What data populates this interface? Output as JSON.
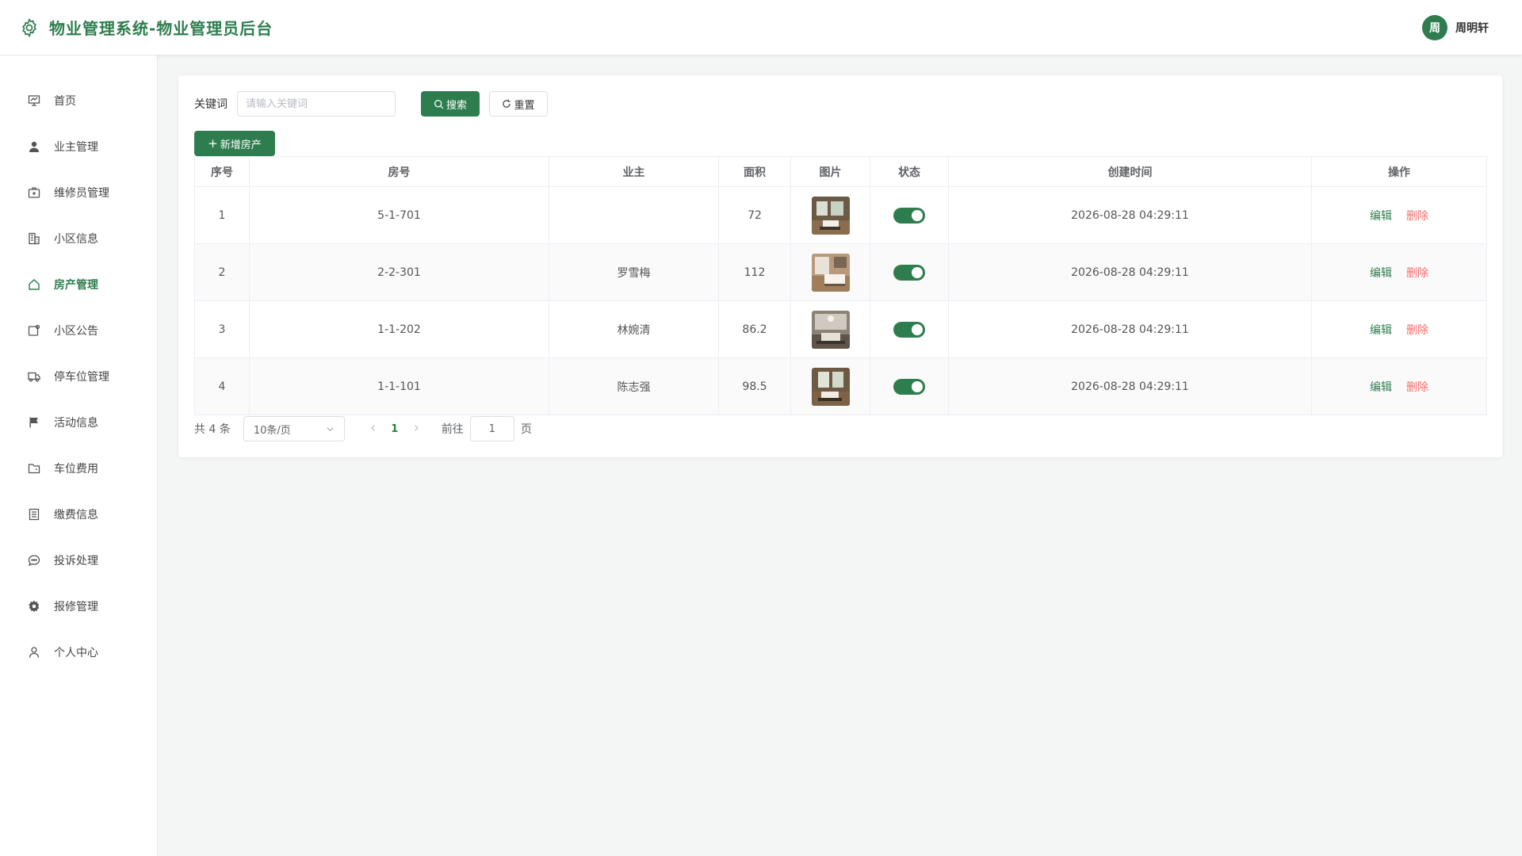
{
  "app": {
    "title": "物业管理系统-物业管理员后台",
    "accent": "#2e7d4f",
    "user": {
      "avatar_text": "周",
      "name": "周明轩"
    }
  },
  "sidebar": {
    "items": [
      {
        "label": "首页",
        "icon": "dashboard-icon",
        "active": false
      },
      {
        "label": "业主管理",
        "icon": "user-icon",
        "active": false
      },
      {
        "label": "维修员管理",
        "icon": "medkit-icon",
        "active": false
      },
      {
        "label": "小区信息",
        "icon": "building-icon",
        "active": false
      },
      {
        "label": "房产管理",
        "icon": "house-icon",
        "active": true
      },
      {
        "label": "小区公告",
        "icon": "notice-icon",
        "active": false
      },
      {
        "label": "停车位管理",
        "icon": "truck-icon",
        "active": false
      },
      {
        "label": "活动信息",
        "icon": "flag-icon",
        "active": false
      },
      {
        "label": "车位费用",
        "icon": "folder-icon",
        "active": false
      },
      {
        "label": "缴费信息",
        "icon": "document-icon",
        "active": false
      },
      {
        "label": "投诉处理",
        "icon": "chat-icon",
        "active": false
      },
      {
        "label": "报修管理",
        "icon": "gear-icon",
        "active": false
      },
      {
        "label": "个人中心",
        "icon": "person-icon",
        "active": false
      }
    ]
  },
  "search": {
    "label": "关键词",
    "placeholder": "请输入关键词",
    "value": "",
    "search_button": "搜索",
    "reset_button": "重置"
  },
  "toolbar": {
    "add_button": "新增房产"
  },
  "table": {
    "columns": [
      "序号",
      "房号",
      "业主",
      "面积",
      "图片",
      "状态",
      "创建时间",
      "操作"
    ],
    "edit_label": "编辑",
    "delete_label": "删除",
    "rows": [
      {
        "index": "1",
        "room": "5-1-701",
        "owner": "",
        "area": "72",
        "status_on": true,
        "created": "2026-08-28 04:29:11"
      },
      {
        "index": "2",
        "room": "2-2-301",
        "owner": "罗雪梅",
        "area": "112",
        "status_on": true,
        "created": "2026-08-28 04:29:11"
      },
      {
        "index": "3",
        "room": "1-1-202",
        "owner": "林婉清",
        "area": "86.2",
        "status_on": true,
        "created": "2026-08-28 04:29:11"
      },
      {
        "index": "4",
        "room": "1-1-101",
        "owner": "陈志强",
        "area": "98.5",
        "status_on": true,
        "created": "2026-08-28 04:29:11"
      }
    ]
  },
  "pagination": {
    "total": "共 4 条",
    "page_size": "10条/页",
    "current_page": "1",
    "goto_label": "前往",
    "goto_value": "1",
    "page_suffix": "页"
  }
}
